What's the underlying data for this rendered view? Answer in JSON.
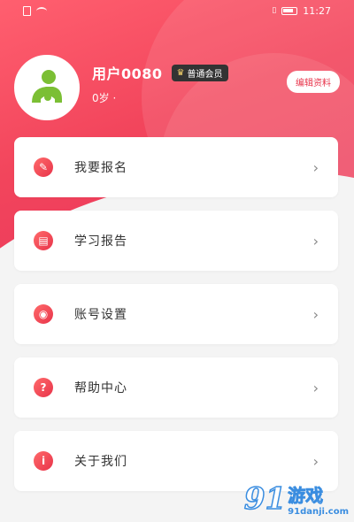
{
  "status_bar": {
    "time": "11:27",
    "icons": [
      "sim-icon",
      "wifi-icon",
      "vibrate-icon",
      "battery-icon"
    ]
  },
  "profile": {
    "username": "用户0080",
    "vip_label": "普通会员",
    "age": "0岁 ·",
    "edit_button": "编辑资料"
  },
  "menu": [
    {
      "label": "我要报名",
      "icon": "pencil-icon"
    },
    {
      "label": "学习报告",
      "icon": "report-icon"
    },
    {
      "label": "账号设置",
      "icon": "settings-icon"
    },
    {
      "label": "帮助中心",
      "icon": "help-icon"
    },
    {
      "label": "关于我们",
      "icon": "info-icon"
    }
  ],
  "watermark": {
    "logo": "91",
    "title": "游戏",
    "url": "91danji.com"
  },
  "colors": {
    "header_gradient_start": "#ff5f6f",
    "header_gradient_end": "#e8335a",
    "accent": "#e8334a",
    "background": "#f4f4f4"
  }
}
